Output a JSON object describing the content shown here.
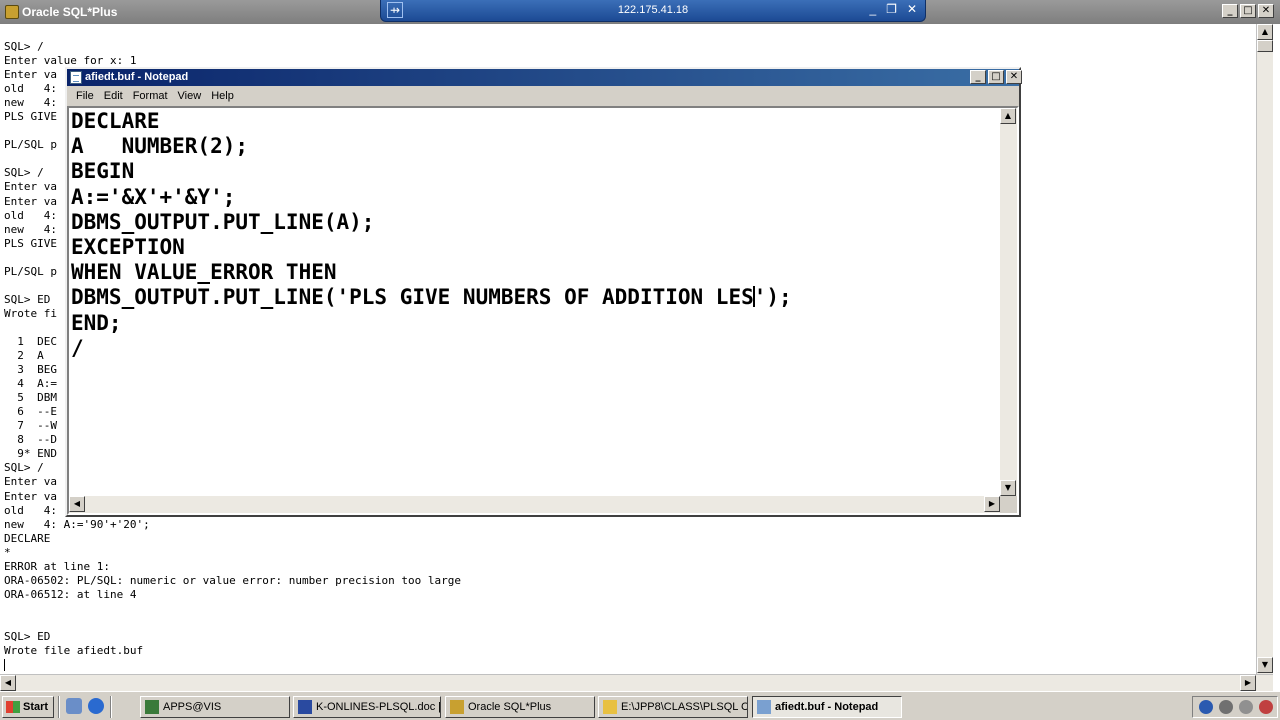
{
  "sqlplus_window": {
    "title": "Oracle SQL*Plus",
    "console_lines": [
      "SQL> /",
      "Enter value for x: 1",
      "Enter va",
      "old   4:",
      "new   4:",
      "PLS GIVE",
      "",
      "PL/SQL p",
      "",
      "SQL> /",
      "Enter va",
      "Enter va",
      "old   4:",
      "new   4:",
      "PLS GIVE",
      "",
      "PL/SQL p",
      "",
      "SQL> ED",
      "Wrote fi",
      "",
      "  1  DEC",
      "  2  A",
      "  3  BEG",
      "  4  A:=",
      "  5  DBM",
      "  6  --E",
      "  7  --W",
      "  8  --D",
      "  9* END",
      "SQL> /",
      "Enter va",
      "Enter va",
      "old   4:",
      "new   4: A:='90'+'20';",
      "DECLARE",
      "*",
      "ERROR at line 1:",
      "ORA-06502: PL/SQL: numeric or value error: number precision too large",
      "ORA-06512: at line 4",
      "",
      "",
      "SQL> ED",
      "Wrote file afiedt.buf"
    ]
  },
  "remote_bar": {
    "ip": "122.175.41.18",
    "pin_icon": "pin-icon",
    "controls": [
      "_",
      "❐",
      "✕"
    ]
  },
  "notepad": {
    "title": "afiedt.buf - Notepad",
    "menu": [
      "File",
      "Edit",
      "Format",
      "View",
      "Help"
    ],
    "code_before_caret": "DECLARE\nA   NUMBER(2);\nBEGIN\nA:='&X'+'&Y';\nDBMS_OUTPUT.PUT_LINE(A);\nEXCEPTION\nWHEN VALUE_ERROR THEN\nDBMS_OUTPUT.PUT_LINE('PLS GIVE NUMBERS OF ADDITION LES",
    "code_after_caret": "');\nEND;\n/"
  },
  "taskbar": {
    "start_label": "Start",
    "tasks": [
      {
        "label": "APPS@VIS",
        "icon": "sqlplus-icon"
      },
      {
        "label": "K-ONLINES-PLSQL.doc [...",
        "icon": "word-icon"
      },
      {
        "label": "Oracle SQL*Plus",
        "icon": "sqlplus-icon"
      },
      {
        "label": "E:\\JPP8\\CLASS\\PLSQL Cl...",
        "icon": "folder-icon"
      },
      {
        "label": "afiedt.buf - Notepad",
        "icon": "notepad-icon"
      }
    ]
  },
  "colors": {
    "notepad_title_start": "#0a246a",
    "notepad_title_end": "#3a6ea5",
    "remote_bar": "#1c4a94",
    "chrome": "#d4d0c8"
  }
}
